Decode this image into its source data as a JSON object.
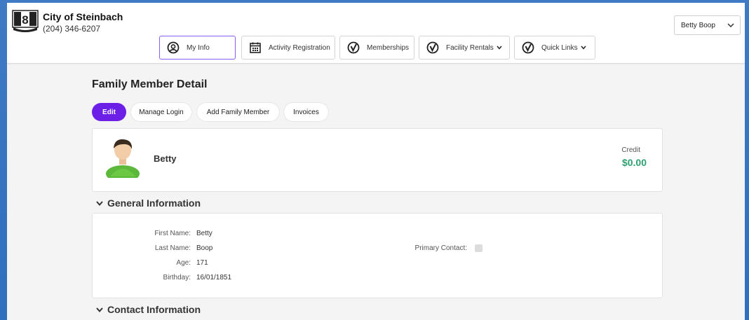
{
  "org": {
    "name": "City of Steinbach",
    "phone": "(204) 346-6207"
  },
  "user_select": {
    "value": "Betty Boop"
  },
  "nav": [
    {
      "label": "My Info",
      "icon": "user-circle-icon",
      "active": true
    },
    {
      "label": "Activity Registration",
      "icon": "calendar-icon"
    },
    {
      "label": "Memberships",
      "icon": "check-circle-icon"
    },
    {
      "label": "Facility Rentals",
      "icon": "check-circle-icon",
      "dropdown": true
    },
    {
      "label": "Quick Links",
      "icon": "check-circle-icon",
      "dropdown": true
    }
  ],
  "page": {
    "title": "Family Member Detail"
  },
  "actions": {
    "edit": "Edit",
    "manage_login": "Manage Login",
    "add_family_member": "Add Family Member",
    "invoices": "Invoices"
  },
  "profile": {
    "name": "Betty",
    "credit_label": "Credit",
    "credit_value": "$0.00"
  },
  "sections": {
    "general": "General Information",
    "contact": "Contact Information"
  },
  "general_info": {
    "first_name_label": "First Name:",
    "first_name": "Betty",
    "last_name_label": "Last Name:",
    "last_name": "Boop",
    "age_label": "Age:",
    "age": "171",
    "birthday_label": "Birthday:",
    "birthday": "16/01/1851",
    "primary_contact_label": "Primary Contact:"
  },
  "colors": {
    "accent": "#6c1fe6",
    "active_border": "#8b5cf6",
    "credit": "#2e9f6f",
    "frame": "#2f6fbe"
  }
}
